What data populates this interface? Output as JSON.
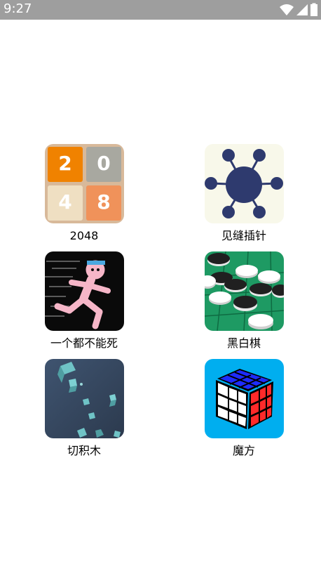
{
  "status_bar": {
    "time": "9:27",
    "icons": [
      "wifi-icon",
      "cellular-signal-icon",
      "battery-icon"
    ]
  },
  "apps": [
    {
      "label": "2048",
      "icon": "tile-2048-icon",
      "tiles": [
        "2",
        "0",
        "4",
        "8"
      ]
    },
    {
      "label": "见缝插针",
      "icon": "pin-wheel-icon"
    },
    {
      "label": "一个都不能死",
      "icon": "running-stickman-icon"
    },
    {
      "label": "黑白棋",
      "icon": "othello-board-icon"
    },
    {
      "label": "切积木",
      "icon": "floating-blocks-icon"
    },
    {
      "label": "魔方",
      "icon": "rubiks-cube-icon"
    }
  ],
  "colors": {
    "status_bar": "#9e9e9e",
    "tile_2": "#f08200",
    "tile_0": "#a8a8a0",
    "tile_4": "#efdfc2",
    "tile_8": "#f0925a",
    "pin_blue": "#2e3a6e",
    "othello_green": "#1e9a63",
    "rubik_bg": "#00aeef"
  }
}
